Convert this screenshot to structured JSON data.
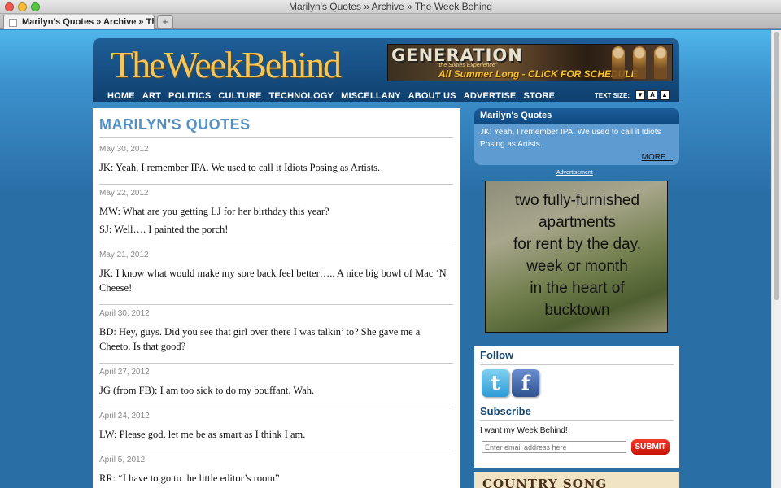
{
  "window": {
    "title": "Marilyn's Quotes » Archive » The Week Behind"
  },
  "tabs": [
    {
      "label": "Marilyn's Quotes » Archive » Th..."
    }
  ],
  "new_tab_label": "+",
  "header": {
    "logo": "TheWeekBehind",
    "banner": {
      "title": "GENERATION",
      "subtitle": "\"the Sixties Experience\"",
      "cta": "All Summer Long - CLICK FOR SCHEDULE"
    },
    "nav": [
      "HOME",
      "ART",
      "POLITICS",
      "CULTURE",
      "TECHNOLOGY",
      "MISCELLANY",
      "ABOUT US",
      "ADVERTISE",
      "STORE"
    ],
    "text_size": {
      "label": "TEXT SIZE:",
      "buttons": [
        "▼",
        "A",
        "▲"
      ]
    }
  },
  "main": {
    "title": "MARILYN'S QUOTES",
    "quotes": [
      {
        "date": "May 30, 2012",
        "lines": [
          "JK: Yeah, I remember IPA. We used to call it Idiots Posing as Artists."
        ]
      },
      {
        "date": "May 22, 2012",
        "lines": [
          "MW: What are you getting LJ for her birthday this year?",
          "SJ: Well…. I painted the porch!"
        ]
      },
      {
        "date": "May 21, 2012",
        "lines": [
          "JK: I know what would make my sore back feel better….. A nice big bowl of Mac ‘N Cheese!"
        ]
      },
      {
        "date": "April 30, 2012",
        "lines": [
          "BD: Hey, guys. Did you see that girl over there I was talkin’ to? She gave me a Cheeto. Is that good?"
        ]
      },
      {
        "date": "April 27, 2012",
        "lines": [
          "JG (from FB): I am too sick to do my bouffant. Wah."
        ]
      },
      {
        "date": "April 24, 2012",
        "lines": [
          "LW: Please god, let me be as smart as I think I am."
        ]
      },
      {
        "date": "April 5, 2012",
        "lines": [
          "RR: “I have to go to the little editor’s room”"
        ]
      }
    ]
  },
  "sidebar": {
    "quote_box": {
      "title": "Marilyn's Quotes",
      "text": "JK: Yeah, I remember IPA. We used to call it Idiots Posing as Artists.",
      "more": "MORE..."
    },
    "ad_label": "Advertisement",
    "ad_text": [
      "two fully-furnished",
      "apartments",
      "for rent by the day,",
      "week or month",
      "in the heart of",
      "bucktown"
    ],
    "follow": {
      "title": "Follow",
      "twitter_glyph": "t",
      "facebook_glyph": "f"
    },
    "subscribe": {
      "title": "Subscribe",
      "text": "I want my Week Behind!",
      "placeholder": "Enter email address here",
      "button": "SUBMIT"
    },
    "bottom_banner": "COUNTRY SONG"
  }
}
